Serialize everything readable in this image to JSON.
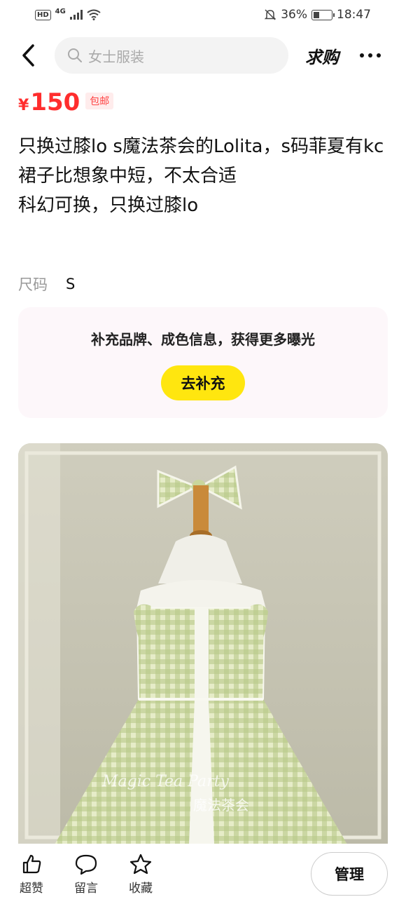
{
  "status_bar": {
    "network_badge": "HD",
    "network_type": "4G",
    "battery_percent": "36%",
    "battery_level": 0.36,
    "time": "18:47"
  },
  "header": {
    "search_placeholder": "女士服装",
    "action_label": "求购",
    "icons": [
      "back-chevron-icon",
      "search-icon",
      "more-icon"
    ]
  },
  "listing": {
    "currency": "¥",
    "price": "150",
    "shipping_tag": "包邮",
    "description_lines": [
      "只换过膝lo s魔法茶会的Lolita，s码菲夏有kc",
      "裙子比想象中短，不太合适",
      "科幻可换，只换过膝lo"
    ],
    "size_label": "尺码",
    "size_value": "S"
  },
  "supplement": {
    "text": "补充品牌、成色信息，获得更多曝光",
    "button_label": "去补充"
  },
  "photo": {
    "watermark_text": "Magic Tea Party",
    "watermark_sub": "魔法茶会"
  },
  "bottom_bar": {
    "like_label": "超赞",
    "comment_label": "留言",
    "favorite_label": "收藏",
    "manage_label": "管理"
  },
  "colors": {
    "price": "#ff2d2d",
    "accent_button": "#ffe60f",
    "card_background": "#fdf7fa"
  }
}
